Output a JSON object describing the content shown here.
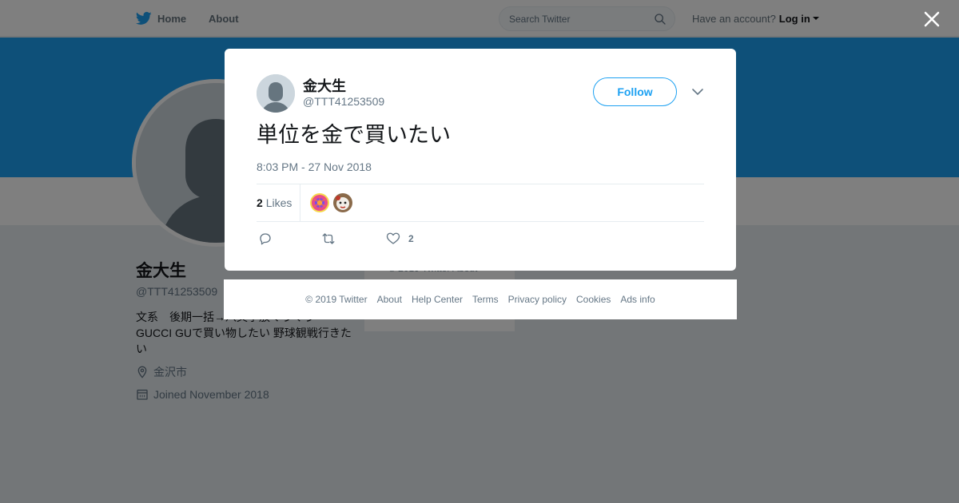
{
  "topbar": {
    "home_label": "Home",
    "about_label": "About",
    "search_placeholder": "Search Twitter",
    "account_prompt": "Have an account?",
    "login_label": "Log in"
  },
  "profile": {
    "name": "金大生",
    "handle": "@TTT41253509",
    "bio": "文系　後期一括→八文字放ぐうぐう GUCCI GUで買い物したい 野球観戦行きたい",
    "location": "金沢市",
    "joined": "Joined November 2018",
    "side_footer": "© 2019 Twitter   About"
  },
  "tweet": {
    "author_name": "金大生",
    "author_handle": "@TTT41253509",
    "follow_label": "Follow",
    "text": "単位を金で買いたい",
    "timestamp": "8:03 PM - 27 Nov 2018",
    "likes_count": "2",
    "likes_label": "Likes",
    "like_action_count": "2"
  },
  "footer": {
    "copyright": "© 2019 Twitter",
    "links": [
      "About",
      "Help Center",
      "Terms",
      "Privacy policy",
      "Cookies",
      "Ads info"
    ]
  },
  "colors": {
    "brand": "#1da1f2",
    "text": "#14171a",
    "muted": "#657786",
    "overlay": "rgba(0,0,0,0.5)"
  },
  "icons": [
    "twitter-bird-icon",
    "search-icon",
    "close-icon",
    "chevron-down-icon",
    "reply-icon",
    "retweet-icon",
    "heart-icon",
    "location-icon",
    "calendar-icon"
  ]
}
